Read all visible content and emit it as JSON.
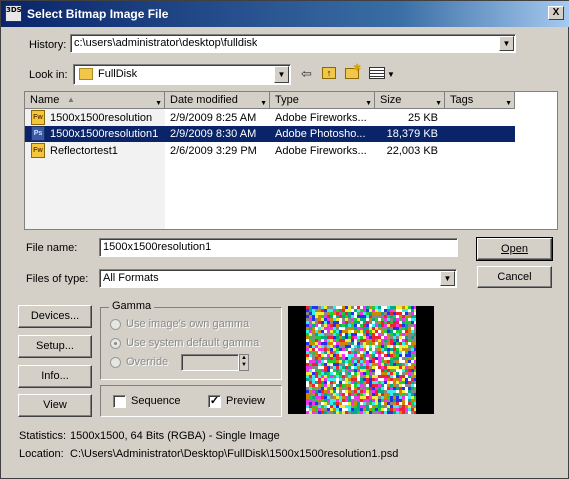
{
  "dialog": {
    "title": "Select Bitmap Image File",
    "app_icon_text": "3DS",
    "close_label": "X"
  },
  "history": {
    "label": "History:",
    "value": "c:\\users\\administrator\\desktop\\fulldisk"
  },
  "look_in": {
    "label": "Look in:",
    "value": "FullDisk"
  },
  "toolbar": {
    "back_icon": "back-arrow-icon",
    "up_icon": "up-folder-icon",
    "new_folder_icon": "new-folder-icon",
    "view_menu_icon": "view-menu-icon"
  },
  "file_list": {
    "columns": [
      "Name",
      "Date modified",
      "Type",
      "Size",
      "Tags"
    ],
    "rows": [
      {
        "name": "1500x1500resolution",
        "date": "2/9/2009 8:25 AM",
        "type": "Adobe Fireworks...",
        "size": "25 KB",
        "icon": "Fw",
        "selected": false
      },
      {
        "name": "1500x1500resolution1",
        "date": "2/9/2009 8:30 AM",
        "type": "Adobe Photosho...",
        "size": "18,379 KB",
        "icon": "Ps",
        "selected": true
      },
      {
        "name": "Reflectortest1",
        "date": "2/6/2009 3:29 PM",
        "type": "Adobe Fireworks...",
        "size": "22,003 KB",
        "icon": "Fw",
        "selected": false
      }
    ]
  },
  "file_name": {
    "label": "File name:",
    "value": "1500x1500resolution1"
  },
  "files_of_type": {
    "label": "Files of type:",
    "value": "All Formats"
  },
  "buttons": {
    "open": "Open",
    "cancel": "Cancel",
    "devices": "Devices...",
    "setup": "Setup...",
    "info": "Info...",
    "view": "View"
  },
  "gamma": {
    "legend": "Gamma",
    "own": "Use image's own gamma",
    "system": "Use system default gamma",
    "override": "Override",
    "override_value": ""
  },
  "options": {
    "sequence": "Sequence",
    "sequence_checked": false,
    "preview": "Preview",
    "preview_checked": true
  },
  "statistics": {
    "label": "Statistics:",
    "value": "1500x1500, 64 Bits (RGBA) - Single Image"
  },
  "location": {
    "label": "Location:",
    "value": "C:\\Users\\Administrator\\Desktop\\FullDisk\\1500x1500resolution1.psd"
  },
  "colors": {
    "title_start": "#0a246a",
    "title_end": "#a6caf0",
    "selection": "#0a246a",
    "dialog_bg": "#d4d0c8"
  }
}
